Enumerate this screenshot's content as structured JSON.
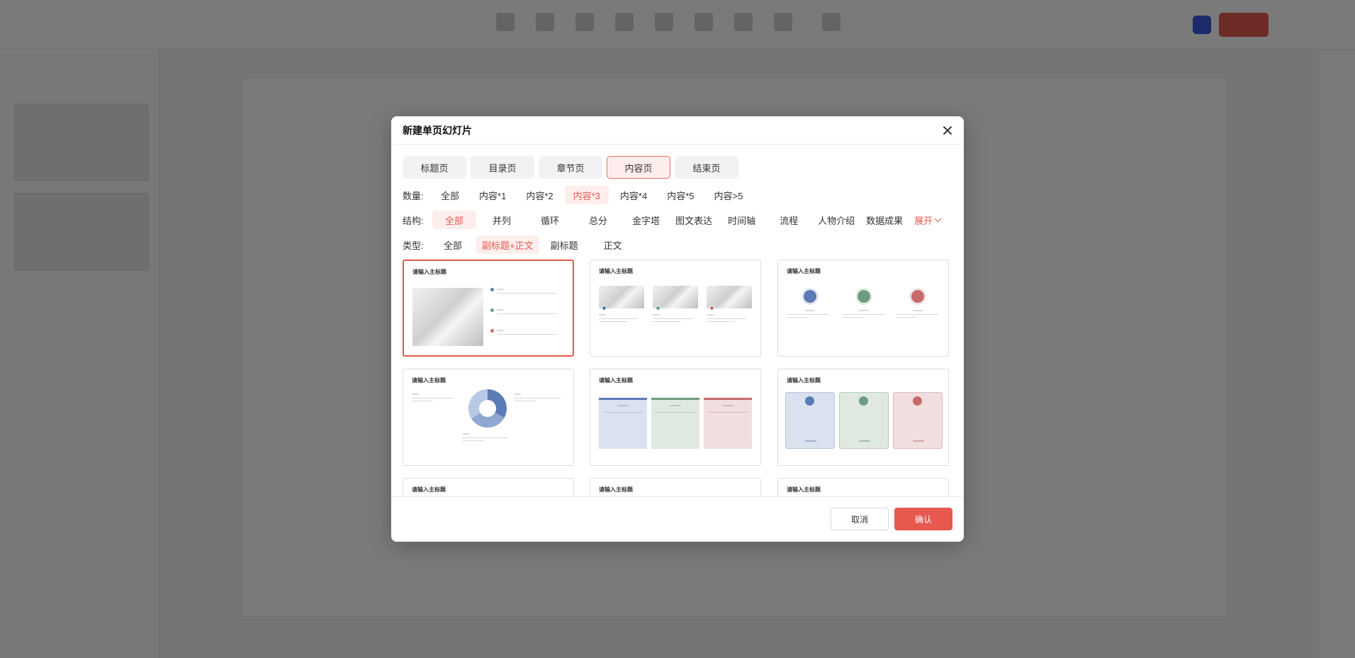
{
  "dialog": {
    "title": "新建单页幻灯片",
    "tabs": [
      {
        "label": "标题页",
        "active": false
      },
      {
        "label": "目录页",
        "active": false
      },
      {
        "label": "章节页",
        "active": false
      },
      {
        "label": "内容页",
        "active": true
      },
      {
        "label": "结束页",
        "active": false
      }
    ],
    "filters": {
      "count": {
        "label": "数量:",
        "options": [
          "全部",
          "内容*1",
          "内容*2",
          "内容*3",
          "内容*4",
          "内容*5",
          "内容>5"
        ],
        "selected": "内容*3"
      },
      "structure": {
        "label": "结构:",
        "options": [
          "全部",
          "并列",
          "循环",
          "总分",
          "金字塔",
          "图文表达",
          "时间轴",
          "流程",
          "人物介绍",
          "数据成果"
        ],
        "selected": "全部",
        "expand_label": "展开"
      },
      "type": {
        "label": "类型:",
        "options": [
          "全部",
          "副标题+正文",
          "副标题",
          "正文"
        ],
        "selected": "副标题+正文"
      }
    },
    "templates": [
      {
        "title": "请输入主标题",
        "selected": true
      },
      {
        "title": "请输入主标题",
        "selected": false
      },
      {
        "title": "请输入主标题",
        "selected": false
      },
      {
        "title": "请输入主标题",
        "selected": false
      },
      {
        "title": "请输入主标题",
        "selected": false
      },
      {
        "title": "请输入主标题",
        "selected": false
      },
      {
        "title": "请输入主标题",
        "selected": false
      },
      {
        "title": "请输入主标题",
        "selected": false
      },
      {
        "title": "请输入主标题",
        "selected": false
      }
    ],
    "buttons": {
      "cancel": "取消",
      "confirm": "确认"
    },
    "colors": {
      "accent": "#e8584f",
      "blue": "#5b7bb5",
      "green": "#6f9c7e",
      "red": "#c86a6a"
    }
  }
}
